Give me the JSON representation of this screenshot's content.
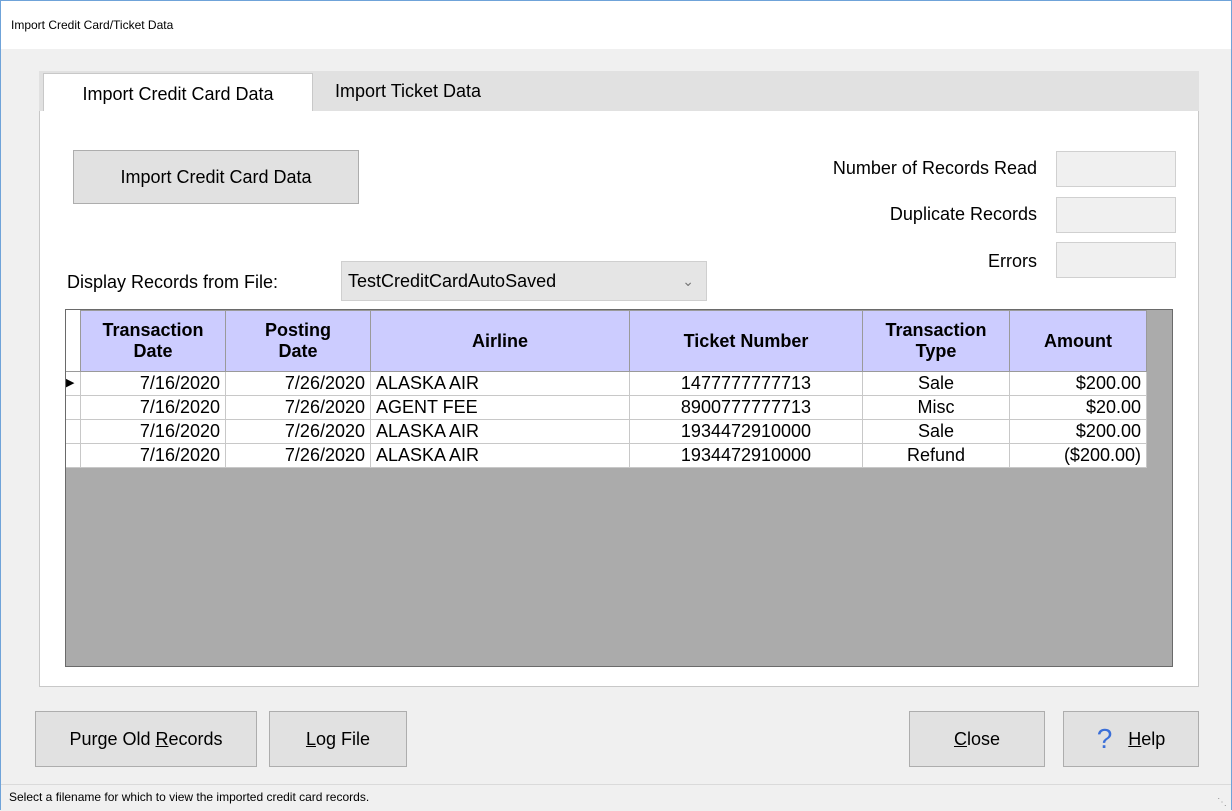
{
  "window": {
    "title": "Import Credit Card/Ticket Data"
  },
  "tabs": [
    {
      "label": "Import Credit Card Data",
      "active": true
    },
    {
      "label": "Import Ticket Data",
      "active": false
    }
  ],
  "import_button": {
    "label": "Import Credit Card Data"
  },
  "stats": {
    "records_read_label": "Number of Records Read",
    "duplicates_label": "Duplicate Records",
    "errors_label": "Errors"
  },
  "file_select": {
    "label": "Display Records from File:",
    "value": "TestCreditCardAutoSaved"
  },
  "table": {
    "headers": [
      [
        "Transaction",
        "Date"
      ],
      [
        "Posting",
        "Date"
      ],
      [
        "Airline"
      ],
      [
        "Ticket Number"
      ],
      [
        "Transaction",
        "Type"
      ],
      [
        "Amount"
      ]
    ],
    "rows": [
      [
        "7/16/2020",
        "7/26/2020",
        "ALASKA AIR",
        "1477777777713",
        "Sale",
        "$200.00"
      ],
      [
        "7/16/2020",
        "7/26/2020",
        "AGENT FEE",
        "8900777777713",
        "Misc",
        "$20.00"
      ],
      [
        "7/16/2020",
        "7/26/2020",
        "ALASKA AIR",
        "1934472910000",
        "Sale",
        "$200.00"
      ],
      [
        "7/16/2020",
        "7/26/2020",
        "ALASKA AIR",
        "1934472910000",
        "Refund",
        "($200.00)"
      ]
    ],
    "current_row_marker": "▶"
  },
  "footer_buttons": {
    "purge": {
      "pre": "Purge Old ",
      "u": "R",
      "post": "ecords"
    },
    "log": {
      "pre": "",
      "u": "L",
      "post": "og File"
    },
    "close": {
      "pre": "",
      "u": "C",
      "post": "lose"
    },
    "help": {
      "pre": "",
      "u": "H",
      "post": "elp"
    }
  },
  "status_bar": {
    "text": "Select a filename for which to view the imported credit card records."
  },
  "colors": {
    "header_bg": "#ccccff",
    "help_icon": "#3b6fd8"
  }
}
